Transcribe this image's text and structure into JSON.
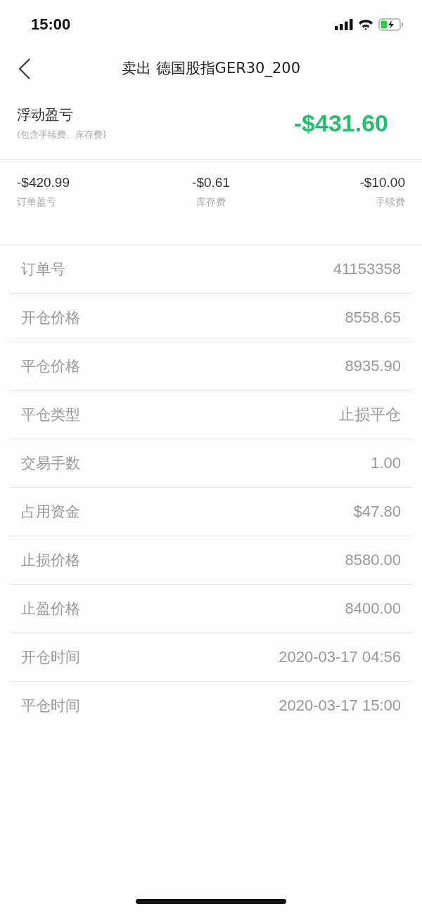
{
  "status_bar": {
    "time": "15:00"
  },
  "header": {
    "title": "卖出 德国股指GER30_200"
  },
  "summary": {
    "label": "浮动盈亏",
    "note": "(包含手续费、库存费)",
    "amount": "-$431.60"
  },
  "breakdown": [
    {
      "value": "-$420.99",
      "label": "订单盈亏"
    },
    {
      "value": "-$0.61",
      "label": "库存费"
    },
    {
      "value": "-$10.00",
      "label": "手续费"
    }
  ],
  "details": [
    {
      "label": "订单号",
      "value": "41153358"
    },
    {
      "label": "开仓价格",
      "value": "8558.65"
    },
    {
      "label": "平仓价格",
      "value": "8935.90"
    },
    {
      "label": "平仓类型",
      "value": "止损平仓"
    },
    {
      "label": "交易手数",
      "value": "1.00"
    },
    {
      "label": "占用资金",
      "value": "$47.80"
    },
    {
      "label": "止损价格",
      "value": "8580.00"
    },
    {
      "label": "止盈价格",
      "value": "8400.00"
    },
    {
      "label": "开仓时间",
      "value": "2020-03-17 04:56"
    },
    {
      "label": "平仓时间",
      "value": "2020-03-17 15:00"
    }
  ]
}
